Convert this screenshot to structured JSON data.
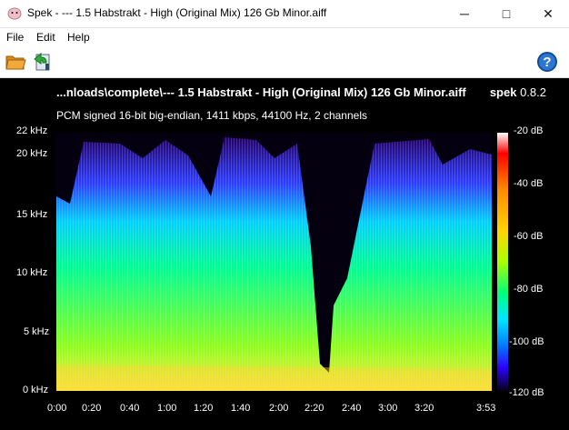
{
  "window": {
    "title": "Spek - --- 1.5 Habstrakt - High (Original Mix) 126  Gb Minor.aiff",
    "controls": {
      "minimize": "─",
      "maximize": "□",
      "close": "✕"
    }
  },
  "menu": {
    "file": "File",
    "edit": "Edit",
    "help": "Help"
  },
  "toolbar": {
    "open_icon": "folder-open-icon",
    "save_icon": "save-icon",
    "help_icon": "help-icon"
  },
  "plot": {
    "file_title": "...nloads\\complete\\--- 1.5 Habstrakt - High (Original Mix) 126  Gb Minor.aiff",
    "app_name": "spek",
    "app_version": "0.8.2",
    "info": "PCM signed 16-bit big-endian, 1411 kbps, 44100 Hz, 2 channels",
    "freq_labels": [
      "22 kHz",
      "20 kHz",
      "15 kHz",
      "10 kHz",
      "5 kHz",
      "0 kHz"
    ],
    "time_labels": [
      "0:00",
      "0:20",
      "0:40",
      "1:00",
      "1:20",
      "1:40",
      "2:00",
      "2:20",
      "2:40",
      "3:00",
      "3:20",
      "3:53"
    ],
    "db_labels": [
      "-20 dB",
      "-40 dB",
      "-60 dB",
      "-80 dB",
      "-100 dB",
      "-120 dB"
    ],
    "colors": {
      "background": "#000000",
      "text": "#ffffff"
    }
  }
}
